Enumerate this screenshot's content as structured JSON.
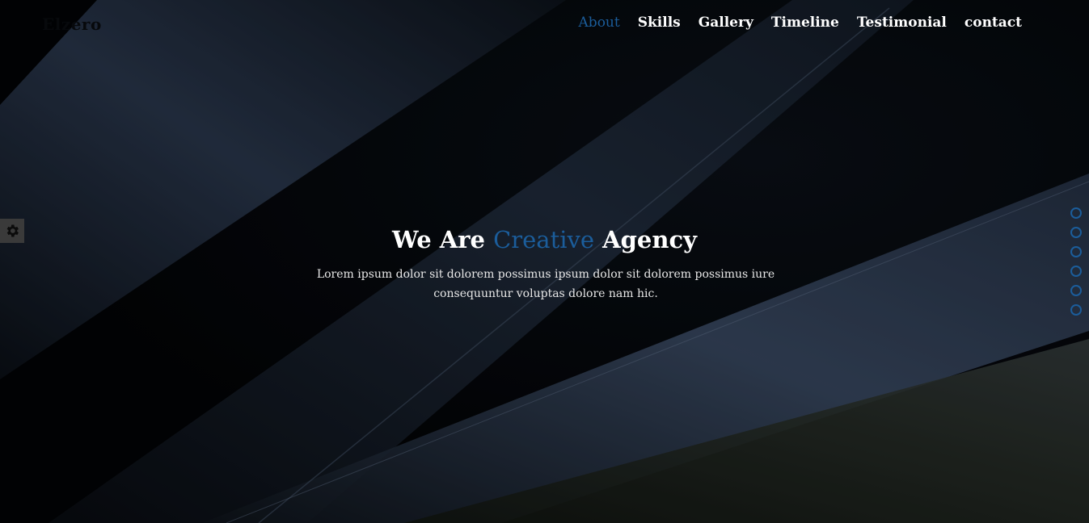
{
  "header": {
    "logo": "Elzero"
  },
  "nav": {
    "items": [
      {
        "label": "About",
        "active": true
      },
      {
        "label": "Skills",
        "active": false
      },
      {
        "label": "Gallery",
        "active": false
      },
      {
        "label": "Timeline",
        "active": false
      },
      {
        "label": "Testimonial",
        "active": false
      },
      {
        "label": "contact",
        "active": false
      }
    ]
  },
  "settings": {
    "icon": "gear-icon"
  },
  "hero": {
    "title_before": "We Are ",
    "title_accent": "Creative",
    "title_after": " Agency",
    "description": "Lorem ipsum dolor sit dolorem possimus ipsum dolor sit dolorem possimus iure consequuntur voluptas dolore nam hic."
  },
  "bullets": {
    "count": 6
  },
  "colors": {
    "accent": "#1b5d9b",
    "text": "#ffffff",
    "background": "#030507"
  }
}
